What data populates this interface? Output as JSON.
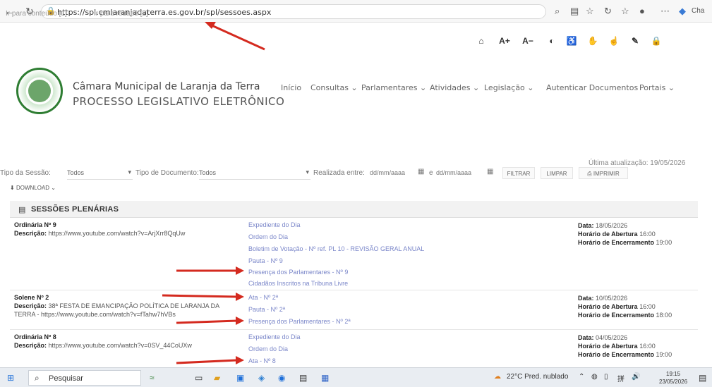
{
  "browser": {
    "url": "https://spl.cmlaranjadaterra.es.gov.br/spl/sessoes.aspx",
    "profile_label": "Cha"
  },
  "accessibility": {
    "skip_content": "Ir para conteúdo [1]",
    "skip_footer": "Ir para rodapé [2]",
    "buttons": [
      "A+",
      "A−"
    ]
  },
  "header": {
    "org_name": "Câmara Municipal de Laranja da Terra",
    "system_name": "PROCESSO LEGISLATIVO ELETRÔNICO",
    "nav": [
      "Início",
      "Consultas ⌄",
      "Parlamentares ⌄",
      "Atividades ⌄",
      "Legislação ⌄",
      "Autenticar Documentos",
      "Portais ⌄"
    ]
  },
  "filters": {
    "updated": "Última atualização: 19/05/2026",
    "session_type_label": "Tipo da Sessão:",
    "session_type_value": "Todos",
    "doc_type_label": "Tipo de Documento:",
    "doc_type_value": "Todos",
    "performed_label": "Realizada entre:",
    "date_from": "dd/mm/aaaa",
    "and": "e",
    "date_to": "dd/mm/aaaa",
    "filter_btn": "FILTRAR",
    "clear_btn": "LIMPAR",
    "print_btn": "IMPRIMIR",
    "download": "DOWNLOAD ⌄"
  },
  "panel": {
    "title": "SESSÕES PLENÁRIAS"
  },
  "labels": {
    "desc": "Descrição:",
    "date": "Data:",
    "opening": "Horário de Abertura",
    "closing": "Horário de Encerramento"
  },
  "sessions": [
    {
      "title": "Ordinária Nº 9",
      "description": "https://www.youtube.com/watch?v=ArjXrr8QqUw",
      "docs": [
        "Expediente do Dia",
        "Ordem do Dia",
        "Boletim de Votação - Nº ref. PL 10 - REVISÃO GERAL ANUAL",
        "Pauta - Nº 9",
        "Presença dos Parlamentares - Nº 9",
        "Cidadãos Inscritos na Tribuna Livre"
      ],
      "date": "18/05/2026",
      "opening": "16:00",
      "closing": "19:00"
    },
    {
      "title": "Solene Nº 2",
      "description": "38ª FESTA DE EMANCIPAÇÃO POLÍTICA DE LARANJA DA TERRA - https://www.youtube.com/watch?v=fTahw7hVBs",
      "docs": [
        "Ata - Nº 2ª",
        "Pauta - Nº 2ª",
        "Presença dos Parlamentares - Nº 2ª"
      ],
      "date": "10/05/2026",
      "opening": "16:00",
      "closing": "18:00"
    },
    {
      "title": "Ordinária Nº 8",
      "description": "https://www.youtube.com/watch?v=0SV_44CoUXw",
      "docs": [
        "Expediente do Dia",
        "Ordem do Dia",
        "Ata - Nº 8"
      ],
      "date": "04/05/2026",
      "opening": "16:00",
      "closing": "19:00"
    }
  ],
  "taskbar": {
    "search_placeholder": "Pesquisar",
    "weather": "22°C Pred. nublado",
    "time": "19:15",
    "date": "23/05/2026"
  }
}
